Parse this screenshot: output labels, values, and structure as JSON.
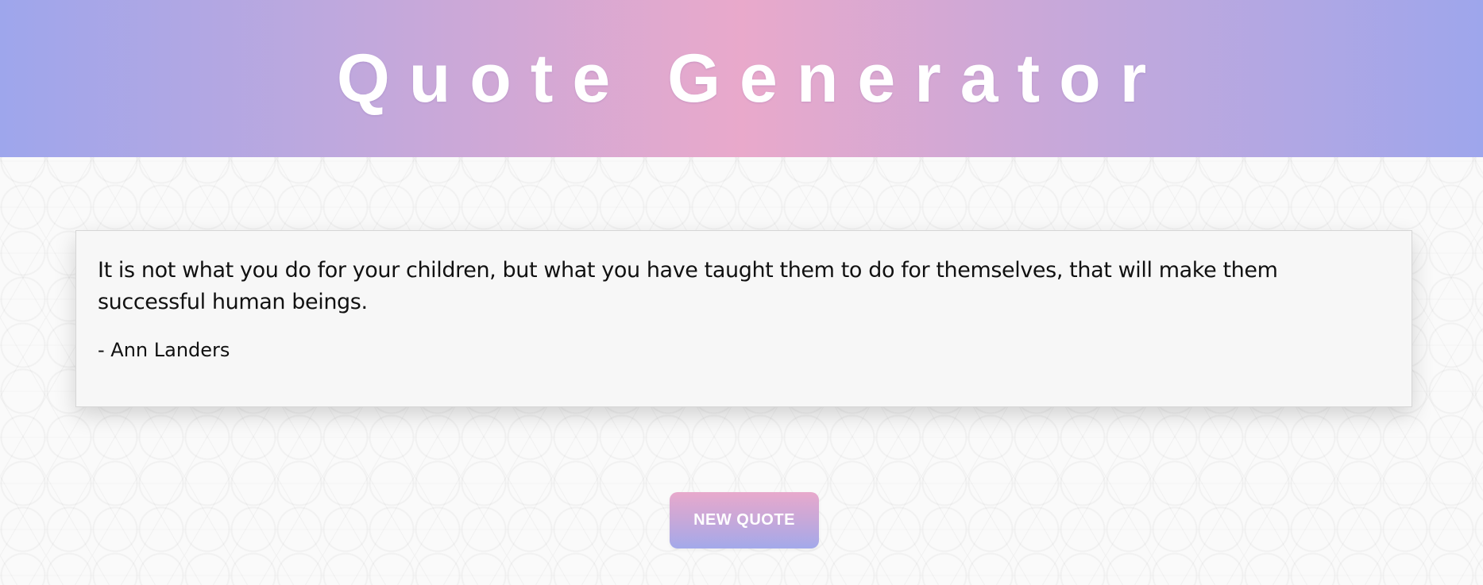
{
  "header": {
    "title": "Quote Generator"
  },
  "quote": {
    "text": "It is not what you do for your children, but what you have taught them to do for themselves, that will make them successful human beings.",
    "author": "- Ann Landers"
  },
  "actions": {
    "new_quote_label": "NEW QUOTE"
  },
  "colors": {
    "header_gradient_edge": "#9ea6ec",
    "header_gradient_center": "#e9a9cb",
    "button_gradient_top": "#e8a9cc",
    "button_gradient_bottom": "#a3a9ea",
    "card_background": "#f7f7f7",
    "title_text": "#ffffff"
  }
}
